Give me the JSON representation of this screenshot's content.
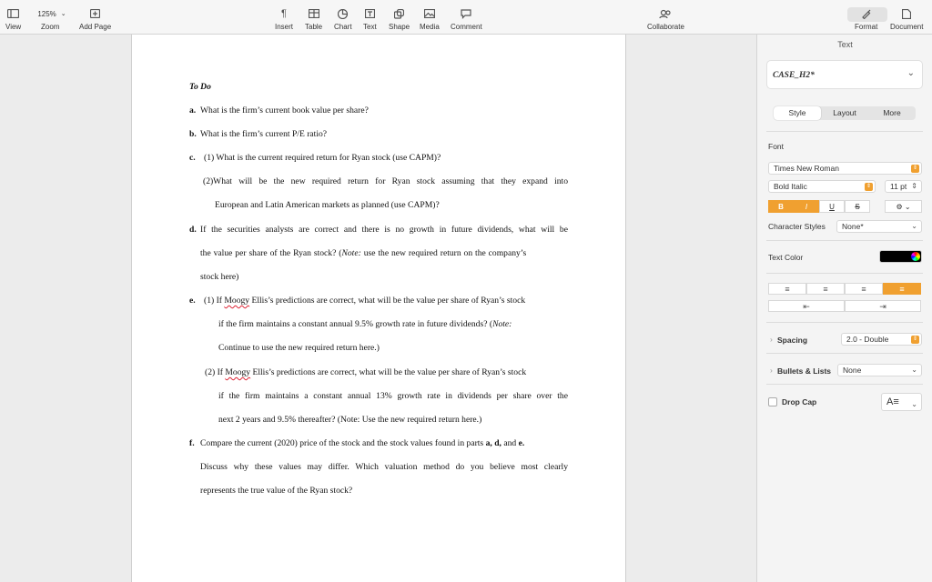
{
  "toolbar": {
    "view": "View",
    "zoom": "Zoom",
    "zoom_value": "125%",
    "add_page": "Add Page",
    "insert": "Insert",
    "table": "Table",
    "chart": "Chart",
    "text": "Text",
    "shape": "Shape",
    "media": "Media",
    "comment": "Comment",
    "collaborate": "Collaborate",
    "format": "Format",
    "document": "Document"
  },
  "document": {
    "heading": "To Do",
    "a_mark": "a.",
    "a_text": "What is the firm’s current book value per share?",
    "b_mark": "b.",
    "b_text": "What is the firm’s current P/E ratio?",
    "c_mark": "c.",
    "c1": "(1) What is the current required return for Ryan stock (use CAPM)?",
    "c2_l1": "(2)What will be the new required return for Ryan stock assuming that they expand into",
    "c2_l2": "European and Latin American markets as planned (use CAPM)?",
    "d_mark": "d.",
    "d_l1": "If the securities analysts are correct and there is no growth in future dividends, what will be",
    "d_l2a": "the value per share of the Ryan stock? (",
    "d_note": "Note:",
    "d_l2b": " use the new required return on the company’s",
    "d_l3": "stock here)",
    "e_mark": "e.",
    "e1_a": "(1) If ",
    "e_name": "Moogy",
    "e1_b": " Ellis’s predictions are correct, what will be the value per share of Ryan’s stock",
    "e1_l2a": "if the firm maintains a constant annual 9.5% growth rate in future dividends? (",
    "e1_note": "Note:",
    "e1_l3": "Continue to use the new required return here.)",
    "e2_a": "(2) If ",
    "e2_name": "Moogy",
    "e2_b": " Ellis’s predictions are correct, what will be the value per share of Ryan’s stock",
    "e2_l2": "if the firm maintains a constant annual 13% growth rate in dividends per share over the",
    "e2_l3": "next 2 years and 9.5% thereafter? (Note: Use the new required return here.)",
    "f_mark": "f.",
    "f_l1a": "Compare the current (2020) price of the stock and the stock values found in parts ",
    "f_a": "a,",
    "f_d": "d,",
    "f_and": " and ",
    "f_e": "e.",
    "f_l2": "Discuss why these values may differ. Which valuation method do you believe most clearly",
    "f_l3": "represents the true value of the Ryan stock?"
  },
  "sidebar": {
    "section": "Text",
    "paragraph_style": "CASE_H2*",
    "tabs": [
      "Style",
      "Layout",
      "More"
    ],
    "font_label": "Font",
    "font_family": "Times New Roman",
    "font_typeface": "Bold Italic",
    "font_size": "11 pt",
    "fmt_buttons": [
      "B",
      "I",
      "U",
      "S"
    ],
    "char_styles_label": "Character Styles",
    "char_styles_value": "None*",
    "text_color_label": "Text Color",
    "text_color": "#000000",
    "spacing_label": "Spacing",
    "spacing_value": "2.0 - Double",
    "bullets_label": "Bullets & Lists",
    "bullets_value": "None",
    "dropcap_label": "Drop Cap",
    "accent": "#f0a030"
  }
}
